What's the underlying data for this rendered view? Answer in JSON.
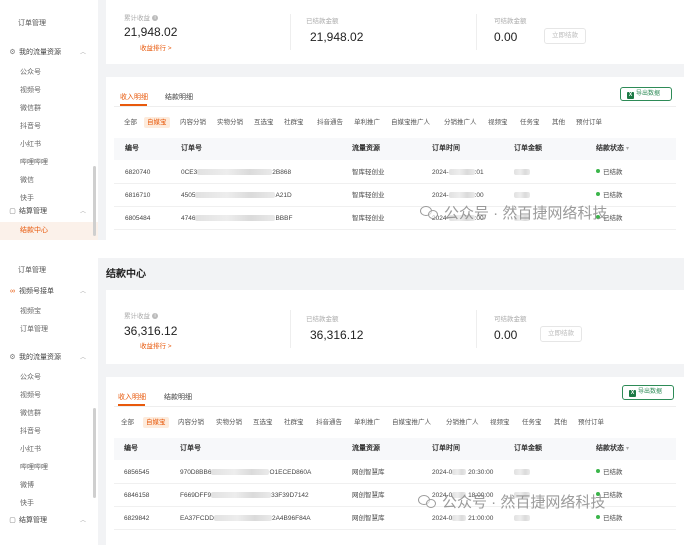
{
  "shot1": {
    "sidebar": {
      "top_items": [
        {
          "label": "订单管理"
        }
      ],
      "group_label": "我的流量资源",
      "items": [
        {
          "label": "公众号"
        },
        {
          "label": "视频号"
        },
        {
          "label": "微信群"
        },
        {
          "label": "抖音号"
        },
        {
          "label": "小红书"
        },
        {
          "label": "哔哩哔哩"
        },
        {
          "label": "微信"
        },
        {
          "label": "快手"
        }
      ],
      "settle_group_label": "结算管理",
      "active_item": "结款中心"
    },
    "summary": {
      "total_income_label": "累计收益",
      "total_income_value": "21,948.02",
      "income_rank_link": "收益排行 >",
      "settled_label": "已结款金额",
      "settled_value": "21,948.02",
      "withdrawable_label": "可结款金额",
      "withdrawable_value": "0.00",
      "withdraw_button": "立即结款"
    },
    "tabs": [
      {
        "label": "收入明细"
      },
      {
        "label": "结款明细"
      }
    ],
    "export_button": "导出数据",
    "filters": [
      "全部",
      "自媒宝",
      "内容分销",
      "实物分销",
      "互选宝",
      "社群宝",
      "抖音通告",
      "单利推广",
      "自媒宝推广人",
      "分销推广人",
      "视频宝",
      "任务宝",
      "其他",
      "预付订单"
    ],
    "columns": {
      "id": "编号",
      "order": "订单号",
      "source": "流量资源",
      "time": "订单时间",
      "amount": "订单金额",
      "status": "结款状态"
    },
    "rows": [
      {
        "id": "6820740",
        "order_prefix": "0CE3",
        "order_suffix": "2B868",
        "source": "智库轻创业",
        "time_prefix": "2024-",
        "time_suffix": ":01",
        "status": "已结款"
      },
      {
        "id": "6816710",
        "order_prefix": "4505",
        "order_suffix": "A21D",
        "source": "智库轻创业",
        "time_prefix": "2024-",
        "time_suffix": ":00",
        "status": "已结款"
      },
      {
        "id": "6805484",
        "order_prefix": "4746",
        "order_suffix": "BBBF",
        "source": "智库轻创业",
        "time_prefix": "2024-",
        "time_suffix": ":00",
        "status": "已结款"
      }
    ]
  },
  "shot2": {
    "page_title": "结款中心",
    "sidebar": {
      "top_items": [
        {
          "label": "订单管理"
        }
      ],
      "video_group_label": "视频号接单",
      "video_items": [
        {
          "label": "视频宝"
        },
        {
          "label": "订单管理"
        }
      ],
      "group_label": "我的流量资源",
      "items": [
        {
          "label": "公众号"
        },
        {
          "label": "视频号"
        },
        {
          "label": "微信群"
        },
        {
          "label": "抖音号"
        },
        {
          "label": "小红书"
        },
        {
          "label": "哔哩哔哩"
        },
        {
          "label": "微博"
        },
        {
          "label": "快手"
        }
      ],
      "settle_group_label": "结算管理"
    },
    "summary": {
      "total_income_label": "累计收益",
      "total_income_value": "36,316.12",
      "income_rank_link": "收益排行 >",
      "settled_label": "已结款金额",
      "settled_value": "36,316.12",
      "withdrawable_label": "可结款金额",
      "withdrawable_value": "0.00",
      "withdraw_button": "立即结款"
    },
    "tabs": [
      {
        "label": "收入明细"
      },
      {
        "label": "结款明细"
      }
    ],
    "export_button": "导出数据",
    "filters": [
      "全部",
      "自媒宝",
      "内容分销",
      "实物分销",
      "互选宝",
      "社群宝",
      "抖音通告",
      "单利推广",
      "自媒宝推广人",
      "分销推广人",
      "视频宝",
      "任务宝",
      "其他",
      "预付订单"
    ],
    "columns": {
      "id": "编号",
      "order": "订单号",
      "source": "流量资源",
      "time": "订单时间",
      "amount": "订单金额",
      "status": "结款状态"
    },
    "rows": [
      {
        "id": "6856545",
        "order_prefix": "970D8BB6",
        "order_suffix": "O1ECED860A",
        "source": "网创智慧库",
        "time_prefix": "2024-0",
        "time_suffix": "20:30:00",
        "status": "已结款"
      },
      {
        "id": "6846158",
        "order_prefix": "F669DFF9",
        "order_suffix": "33F39D7142",
        "source": "网创智慧库",
        "time_prefix": "2024-0",
        "time_suffix": "18:00:00",
        "status": "已结款"
      },
      {
        "id": "6829842",
        "order_prefix": "EA37FCDD",
        "order_suffix": "2A4B96F84A",
        "source": "网创智慧库",
        "time_prefix": "2024-0",
        "time_suffix": "21:00:00",
        "status": "已结款"
      }
    ]
  },
  "watermark": "公众号 · 然百捷网络科技",
  "colors": {
    "accent": "#e8590c",
    "success": "#3bb54a",
    "excel": "#1d7a45"
  }
}
